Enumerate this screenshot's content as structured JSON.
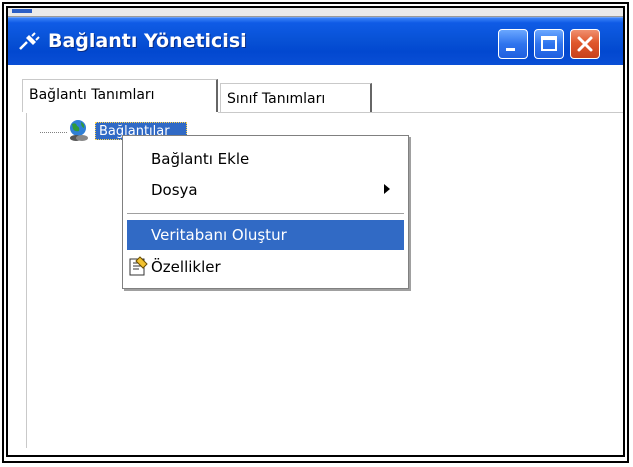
{
  "window": {
    "title": "Bağlantı Yöneticisi",
    "title_icon": "connection-plug-icon",
    "controls": [
      "minimize-icon",
      "maximize-icon",
      "close-icon"
    ]
  },
  "tabs": [
    {
      "label": "Bağlantı Tanımları",
      "active": true
    },
    {
      "label": "Sınıf Tanımları",
      "active": false
    }
  ],
  "tree": {
    "root_label": "Bağlantılar",
    "root_icon": "globe-connection-icon"
  },
  "context_menu": {
    "items": [
      {
        "label": "Bağlantı Ekle"
      },
      {
        "label": "Dosya",
        "has_submenu": true
      },
      {
        "label": "Veritabanı Oluştur",
        "highlighted": true
      },
      {
        "label": "Özellikler",
        "icon": "properties-icon"
      }
    ]
  },
  "colors": {
    "titlebar": "#0852d6",
    "selection": "#316ac5",
    "close_button": "#e0582c"
  }
}
